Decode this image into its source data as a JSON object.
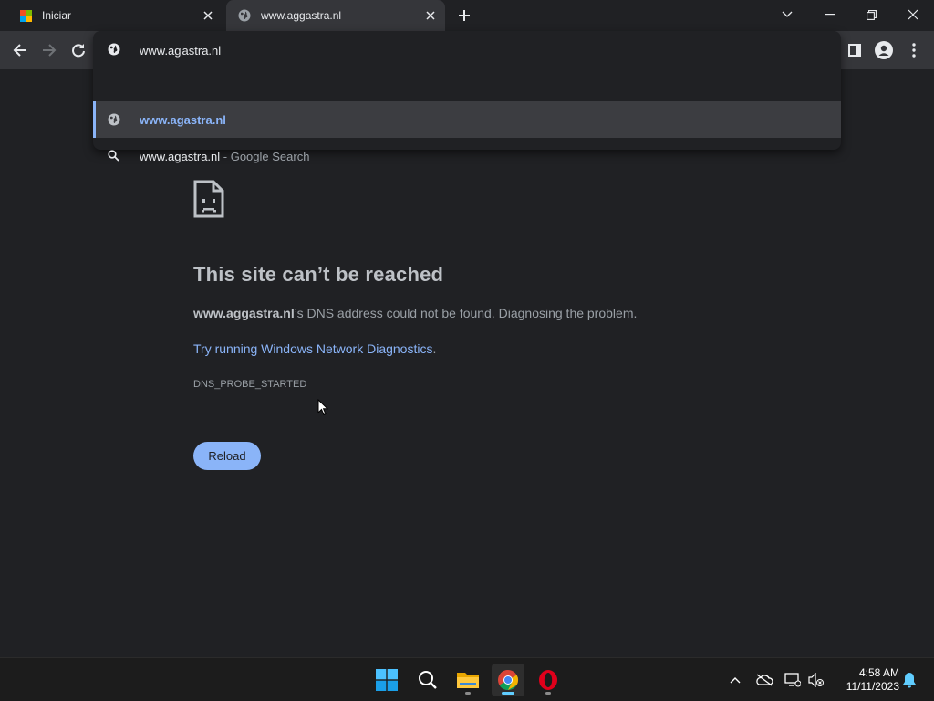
{
  "browser": {
    "tabs": [
      {
        "title": "Iniciar",
        "icon": "windows-logo-icon",
        "active": false
      },
      {
        "title": "www.aggastra.nl",
        "icon": "globe-icon",
        "active": true
      }
    ]
  },
  "omnibox": {
    "typed_before_caret": "www.ag",
    "typed_after_caret": "astra.nl",
    "suggestions": [
      {
        "icon": "globe-icon",
        "text": "www.agastra.nl",
        "suffix": ""
      },
      {
        "icon": "search-icon",
        "text": "www.agastra.nl",
        "suffix": " - Google Search"
      }
    ]
  },
  "error_page": {
    "icon": "sad-page-icon",
    "title": "This site can’t be reached",
    "host": "www.aggastra.nl",
    "description_rest": "’s DNS address could not be found. Diagnosing the problem.",
    "diagnostics_link": "Try running Windows Network Diagnostics",
    "diagnostics_period": ".",
    "error_code": "DNS_PROBE_STARTED",
    "reload_label": "Reload"
  },
  "taskbar": {
    "apps": [
      "start-icon",
      "search-icon",
      "file-explorer-icon",
      "chrome-icon",
      "opera-icon"
    ],
    "active_app": "chrome-icon",
    "time": "4:58 AM",
    "date": "11/11/2023"
  },
  "colors": {
    "page_background": "#202124",
    "toolbar": "#35363a",
    "accent_blue": "#8ab4f8",
    "text_primary": "#e8eaed",
    "text_muted": "#9aa0a6"
  }
}
